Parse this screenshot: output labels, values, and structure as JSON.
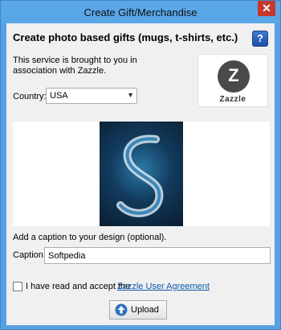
{
  "window": {
    "title": "Create Gift/Merchandise",
    "close_glyph": "✕"
  },
  "header": {
    "heading": "Create photo based gifts (mugs, t-shirts, etc.)",
    "help_glyph": "?"
  },
  "intro": {
    "text": "This service is brought to you in association with Zazzle."
  },
  "partner_logo": {
    "glyph": "Z",
    "text": "Zazzle"
  },
  "country": {
    "label": "Country:",
    "selected": "USA"
  },
  "caption": {
    "hint": "Add a caption to your design (optional).",
    "label": "Caption",
    "value": "Softpedia"
  },
  "agreement": {
    "text": "I have read and accept the",
    "link": "Zazzle User Agreement",
    "checked": false
  },
  "upload": {
    "label": "Upload",
    "icon": "upload-arrow-icon"
  },
  "colors": {
    "title_bar": "#5aa7e8",
    "close_button": "#c4382d",
    "link": "#0b5aa8",
    "help_button": "#2a60b8"
  }
}
